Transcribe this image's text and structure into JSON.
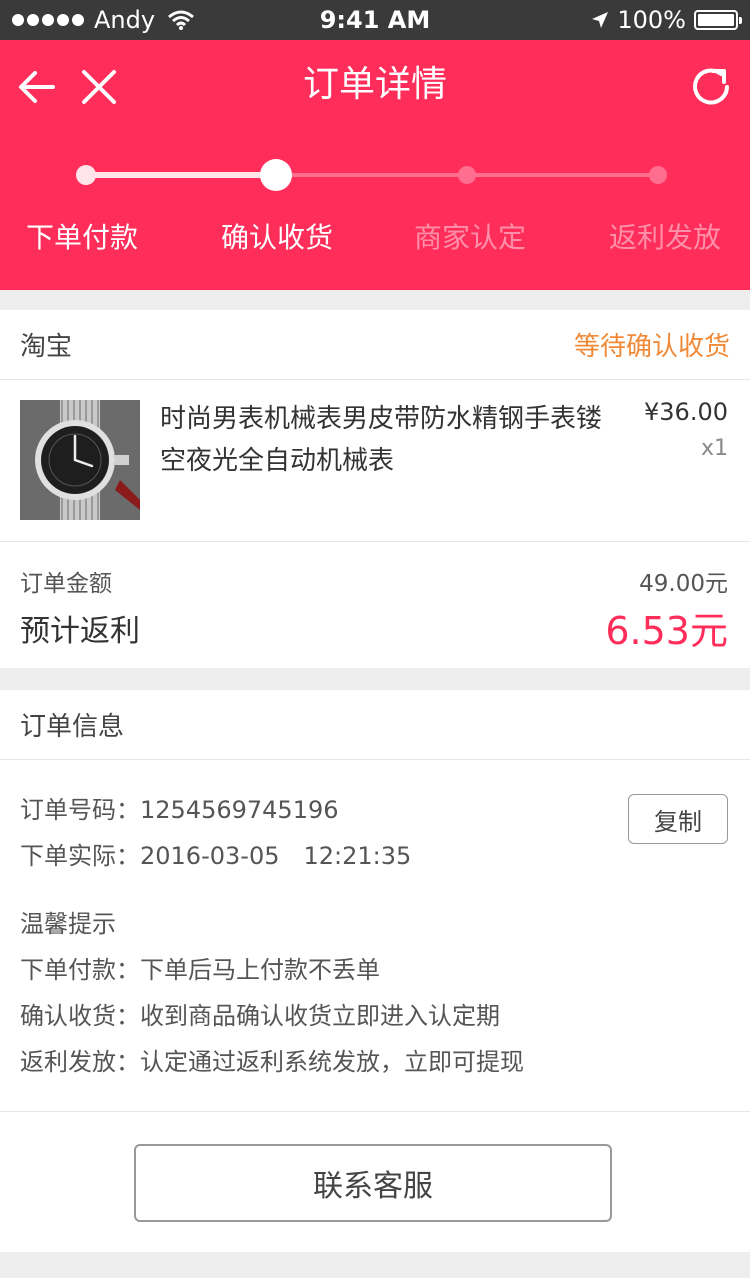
{
  "status_bar": {
    "carrier": "Andy",
    "time": "9:41 AM",
    "battery_text": "100%",
    "battery_level": 1.0,
    "signal_icon": "signal-dots-icon",
    "wifi_icon": "wifi-icon",
    "location_icon": "location-arrow-icon",
    "battery_icon": "battery-icon"
  },
  "header": {
    "title": "订单详情",
    "back_icon": "arrow-left-icon",
    "close_icon": "close-icon",
    "refresh_icon": "refresh-icon",
    "steps": [
      {
        "label": "下单付款",
        "state": "done"
      },
      {
        "label": "确认收货",
        "state": "current"
      },
      {
        "label": "商家认定",
        "state": "todo"
      },
      {
        "label": "返利发放",
        "state": "todo"
      }
    ]
  },
  "order": {
    "store": "淘宝",
    "status": "等待确认收货",
    "product": {
      "title": "时尚男表机械表男皮带防水精钢手表镂空夜光全自动机械表",
      "price": "¥36.00",
      "quantity": "x1",
      "image_icon": "watch-product-image"
    },
    "amount_label": "订单金额",
    "amount_value": "49.00元",
    "rebate_label": "预计返利",
    "rebate_value": "6.53元"
  },
  "info": {
    "title": "订单信息",
    "order_no_label": "订单号码：",
    "order_no": "1254569745196",
    "order_time_label": "下单实际：",
    "order_time": "2016-03-05　12:21:35",
    "copy_label": "复制",
    "tips_title": "温馨提示",
    "tips": [
      {
        "label": "下单付款：",
        "text": "下单后马上付款不丢单"
      },
      {
        "label": "确认收货：",
        "text": "收到商品确认收货立即进入认定期"
      },
      {
        "label": "返利发放：",
        "text": "认定通过返利系统发放，立即可提现"
      }
    ]
  },
  "contact_label": "联系客服",
  "colors": {
    "brand": "#ff2d5a",
    "status_orange": "#f08a39",
    "rebate_red": "#ff2d5a"
  }
}
